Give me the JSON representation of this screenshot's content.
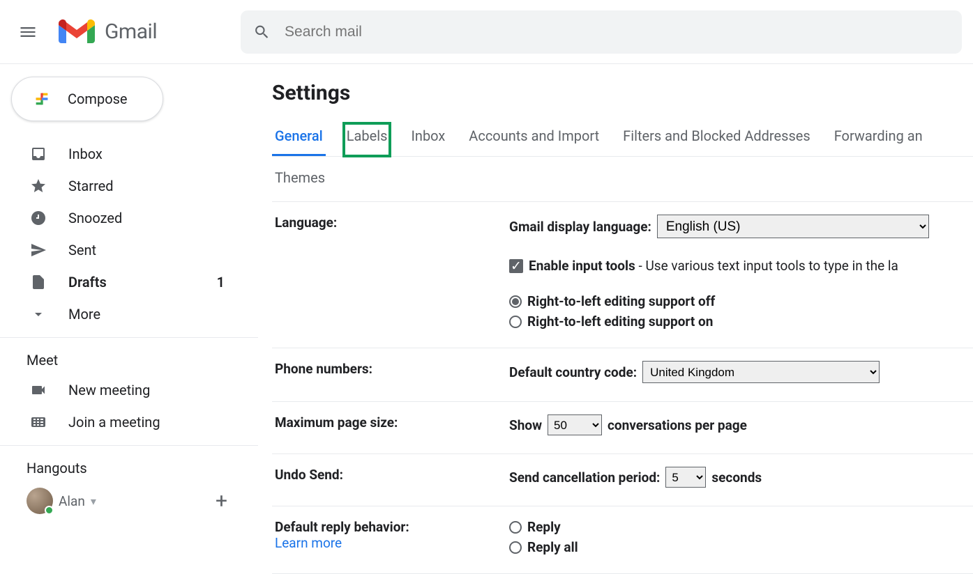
{
  "header": {
    "product": "Gmail",
    "search_placeholder": "Search mail"
  },
  "compose_label": "Compose",
  "sidebar": {
    "items": [
      {
        "label": "Inbox",
        "bold": false
      },
      {
        "label": "Starred",
        "bold": false
      },
      {
        "label": "Snoozed",
        "bold": false
      },
      {
        "label": "Sent",
        "bold": false
      },
      {
        "label": "Drafts",
        "bold": true,
        "count": "1"
      },
      {
        "label": "More",
        "bold": false
      }
    ],
    "meet_title": "Meet",
    "meet_new": "New meeting",
    "meet_join": "Join a meeting",
    "hangouts_title": "Hangouts",
    "user_name": "Alan"
  },
  "settings": {
    "title": "Settings",
    "tabs": [
      "General",
      "Labels",
      "Inbox",
      "Accounts and Import",
      "Filters and Blocked Addresses",
      "Forwarding an"
    ],
    "tabs2": [
      "Themes"
    ],
    "language": {
      "label": "Language:",
      "display_label": "Gmail display language:",
      "display_value": "English (US)",
      "input_tools_label": "Enable input tools",
      "input_tools_desc": " - Use various text input tools to type in the la",
      "rtl_off": "Right-to-left editing support off",
      "rtl_on": "Right-to-left editing support on"
    },
    "phone": {
      "label": "Phone numbers:",
      "country_label": "Default country code:",
      "country_value": "United Kingdom"
    },
    "pagesize": {
      "label": "Maximum page size:",
      "show": "Show",
      "value": "50",
      "suffix": "conversations per page"
    },
    "undo": {
      "label": "Undo Send:",
      "prefix": "Send cancellation period:",
      "value": "5",
      "suffix": "seconds"
    },
    "reply": {
      "label": "Default reply behavior:",
      "learn": "Learn more",
      "opt1": "Reply",
      "opt2": "Reply all"
    }
  }
}
